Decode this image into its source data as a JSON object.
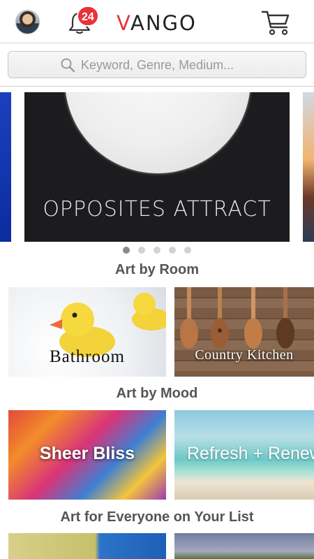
{
  "header": {
    "notification_count": "24",
    "logo_text": "VANGO",
    "logo_first_letter": "V",
    "logo_rest": "ANGO",
    "accent_color": "#e8323b"
  },
  "search": {
    "placeholder": "Keyword, Genre, Medium..."
  },
  "carousel": {
    "slide_caption": "OPPOSITES ATTRACT",
    "page_count": 5,
    "active_page": 1
  },
  "sections": {
    "room_title": "Art by Room",
    "mood_title": "Art by Mood",
    "everyone_title": "Art for Everyone on Your List"
  },
  "room_tiles": [
    {
      "label": "Bathroom"
    },
    {
      "label": "Country Kitchen"
    }
  ],
  "mood_tiles": [
    {
      "label": "Sheer Bliss"
    },
    {
      "label": "Refresh + Renew"
    }
  ],
  "icons": {
    "avatar": "user-avatar",
    "notifications": "bell-icon",
    "cart": "shopping-cart-icon",
    "search": "search-icon"
  }
}
